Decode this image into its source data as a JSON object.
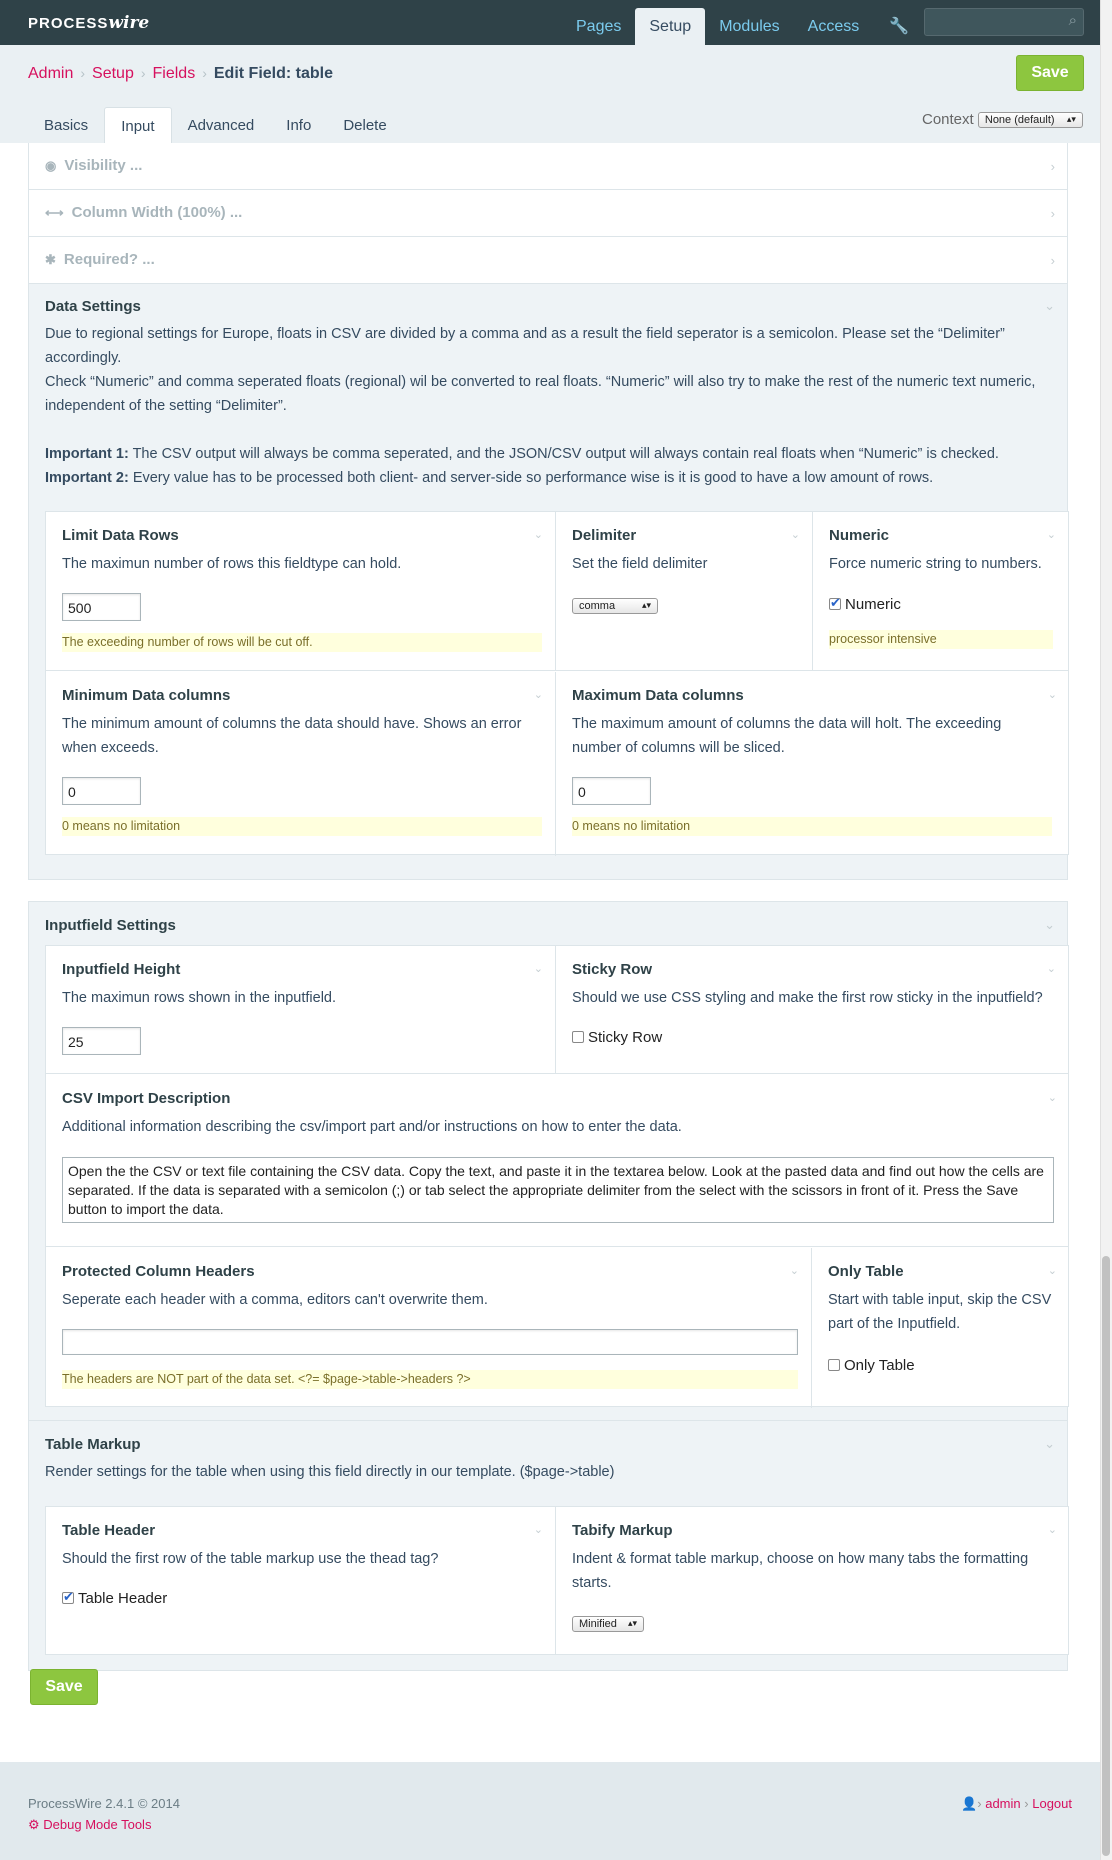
{
  "app": {
    "logo_text": "PROCESS",
    "logo_bold": "wire"
  },
  "topnav": {
    "items": [
      "Pages",
      "Setup",
      "Modules",
      "Access"
    ],
    "active": "Setup"
  },
  "breadcrumbs": {
    "items": [
      "Admin",
      "Setup",
      "Fields"
    ],
    "current": "Edit Field: table"
  },
  "save_label": "Save",
  "tabs": [
    "Basics",
    "Input",
    "Advanced",
    "Info",
    "Delete"
  ],
  "active_tab": "Input",
  "context": {
    "label": "Context",
    "value": "None (default)"
  },
  "collapsed": {
    "visibility": "Visibility ...",
    "column_width": "Column Width (100%) ...",
    "required": "Required? ..."
  },
  "data_settings": {
    "title": "Data Settings",
    "p1": "Due to regional settings for Europe, floats in CSV are divided by a comma and as a result the field seperator is a semicolon. Please set the “Delimiter” accordingly.",
    "p2": "Check “Numeric” and comma seperated floats (regional) wil be converted to real floats. “Numeric” will also try to make the rest of the numeric text numeric, independent of the setting “Delimiter”.",
    "imp1_label": "Important 1:",
    "imp1_text": "The CSV output will always be comma seperated, and the JSON/CSV output will always contain real floats when “Numeric” is checked.",
    "imp2_label": "Important 2:",
    "imp2_text": "Every value has to be processed both client- and server-side so performance wise is it is good to have a low amount of rows.",
    "limit_rows": {
      "title": "Limit Data Rows",
      "desc": "The maximun number of rows this fieldtype can hold.",
      "value": "500",
      "note": "The exceeding number of rows will be cut off."
    },
    "delimiter": {
      "title": "Delimiter",
      "desc": "Set the field delimiter",
      "value": "comma"
    },
    "numeric": {
      "title": "Numeric",
      "desc": "Force numeric string to numbers.",
      "check_label": "Numeric",
      "checked": true,
      "note": "processor intensive"
    },
    "min_cols": {
      "title": "Minimum Data columns",
      "desc": "The minimum amount of columns the data should have. Shows an error when exceeds.",
      "value": "0",
      "note": "0 means no limitation"
    },
    "max_cols": {
      "title": "Maximum Data columns",
      "desc": "The maximum amount of columns the data will holt. The exceeding number of columns will be sliced.",
      "value": "0",
      "note": "0 means no limitation"
    }
  },
  "inputfield_settings": {
    "title": "Inputfield Settings",
    "height": {
      "title": "Inputfield Height",
      "desc": "The maximun rows shown in the inputfield.",
      "value": "25"
    },
    "sticky": {
      "title": "Sticky Row",
      "desc": "Should we use CSS styling and make the first row sticky in the inputfield?",
      "check_label": "Sticky Row",
      "checked": false
    },
    "csv_import": {
      "title": "CSV Import Description",
      "desc": "Additional information describing the csv/import part and/or instructions on how to enter the data.",
      "value": "Open the the CSV or text file containing the CSV data. Copy the text, and paste it in the textarea below. Look at the pasted data and find out how the cells are separated. If the data is separated with a semicolon (;) or tab select the appropriate delimiter from the select with the scissors in front of it. Press the Save button to import the data."
    },
    "protected": {
      "title": "Protected Column Headers",
      "desc": "Seperate each header with a comma, editors can't overwrite them.",
      "value": "",
      "note": "The headers are NOT part of the data set. <?= $page->table->headers ?>"
    },
    "only_table": {
      "title": "Only Table",
      "desc": "Start with table input, skip the CSV part of the Inputfield.",
      "check_label": "Only Table",
      "checked": false
    }
  },
  "table_markup": {
    "title": "Table Markup",
    "desc": "Render settings for the table when using this field directly in our template. ($page->table)",
    "header": {
      "title": "Table Header",
      "desc": "Should the first row of the table markup use the thead tag?",
      "check_label": "Table Header",
      "checked": true
    },
    "tabify": {
      "title": "Tabify Markup",
      "desc": "Indent & format table markup, choose on how many tabs the formatting starts.",
      "value": "Minified"
    }
  },
  "footer": {
    "version": "ProcessWire 2.4.1 © 2014",
    "debug": "Debug Mode Tools",
    "user": "admin",
    "logout": "Logout"
  },
  "icons": {
    "search": "search-icon",
    "wrench": "wrench-icon",
    "eye": "eye-icon",
    "arrows": "arrows-h-icon",
    "asterisk": "asterisk-icon",
    "gear": "gear-icon",
    "user": "user-icon"
  }
}
